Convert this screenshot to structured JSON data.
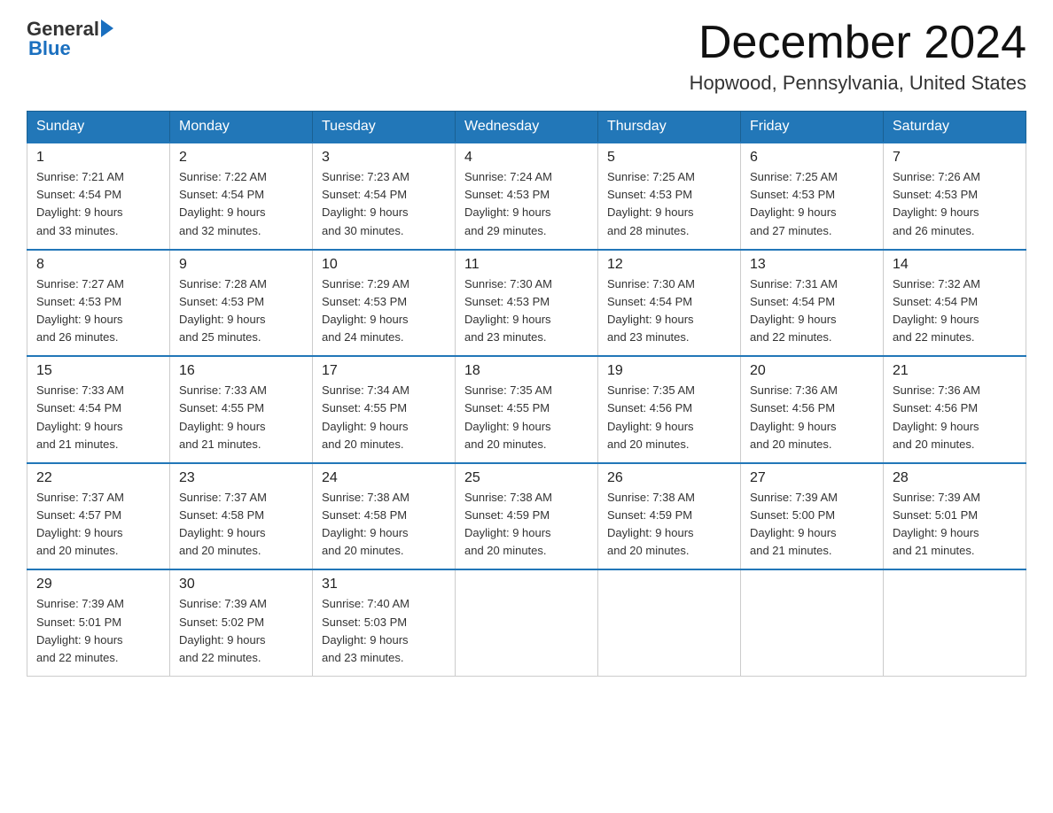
{
  "header": {
    "logo_general": "General",
    "logo_blue": "Blue",
    "title": "December 2024",
    "subtitle": "Hopwood, Pennsylvania, United States"
  },
  "days_of_week": [
    "Sunday",
    "Monday",
    "Tuesday",
    "Wednesday",
    "Thursday",
    "Friday",
    "Saturday"
  ],
  "weeks": [
    [
      {
        "day": "1",
        "sunrise": "7:21 AM",
        "sunset": "4:54 PM",
        "daylight": "9 hours and 33 minutes."
      },
      {
        "day": "2",
        "sunrise": "7:22 AM",
        "sunset": "4:54 PM",
        "daylight": "9 hours and 32 minutes."
      },
      {
        "day": "3",
        "sunrise": "7:23 AM",
        "sunset": "4:54 PM",
        "daylight": "9 hours and 30 minutes."
      },
      {
        "day": "4",
        "sunrise": "7:24 AM",
        "sunset": "4:53 PM",
        "daylight": "9 hours and 29 minutes."
      },
      {
        "day": "5",
        "sunrise": "7:25 AM",
        "sunset": "4:53 PM",
        "daylight": "9 hours and 28 minutes."
      },
      {
        "day": "6",
        "sunrise": "7:25 AM",
        "sunset": "4:53 PM",
        "daylight": "9 hours and 27 minutes."
      },
      {
        "day": "7",
        "sunrise": "7:26 AM",
        "sunset": "4:53 PM",
        "daylight": "9 hours and 26 minutes."
      }
    ],
    [
      {
        "day": "8",
        "sunrise": "7:27 AM",
        "sunset": "4:53 PM",
        "daylight": "9 hours and 26 minutes."
      },
      {
        "day": "9",
        "sunrise": "7:28 AM",
        "sunset": "4:53 PM",
        "daylight": "9 hours and 25 minutes."
      },
      {
        "day": "10",
        "sunrise": "7:29 AM",
        "sunset": "4:53 PM",
        "daylight": "9 hours and 24 minutes."
      },
      {
        "day": "11",
        "sunrise": "7:30 AM",
        "sunset": "4:53 PM",
        "daylight": "9 hours and 23 minutes."
      },
      {
        "day": "12",
        "sunrise": "7:30 AM",
        "sunset": "4:54 PM",
        "daylight": "9 hours and 23 minutes."
      },
      {
        "day": "13",
        "sunrise": "7:31 AM",
        "sunset": "4:54 PM",
        "daylight": "9 hours and 22 minutes."
      },
      {
        "day": "14",
        "sunrise": "7:32 AM",
        "sunset": "4:54 PM",
        "daylight": "9 hours and 22 minutes."
      }
    ],
    [
      {
        "day": "15",
        "sunrise": "7:33 AM",
        "sunset": "4:54 PM",
        "daylight": "9 hours and 21 minutes."
      },
      {
        "day": "16",
        "sunrise": "7:33 AM",
        "sunset": "4:55 PM",
        "daylight": "9 hours and 21 minutes."
      },
      {
        "day": "17",
        "sunrise": "7:34 AM",
        "sunset": "4:55 PM",
        "daylight": "9 hours and 20 minutes."
      },
      {
        "day": "18",
        "sunrise": "7:35 AM",
        "sunset": "4:55 PM",
        "daylight": "9 hours and 20 minutes."
      },
      {
        "day": "19",
        "sunrise": "7:35 AM",
        "sunset": "4:56 PM",
        "daylight": "9 hours and 20 minutes."
      },
      {
        "day": "20",
        "sunrise": "7:36 AM",
        "sunset": "4:56 PM",
        "daylight": "9 hours and 20 minutes."
      },
      {
        "day": "21",
        "sunrise": "7:36 AM",
        "sunset": "4:56 PM",
        "daylight": "9 hours and 20 minutes."
      }
    ],
    [
      {
        "day": "22",
        "sunrise": "7:37 AM",
        "sunset": "4:57 PM",
        "daylight": "9 hours and 20 minutes."
      },
      {
        "day": "23",
        "sunrise": "7:37 AM",
        "sunset": "4:58 PM",
        "daylight": "9 hours and 20 minutes."
      },
      {
        "day": "24",
        "sunrise": "7:38 AM",
        "sunset": "4:58 PM",
        "daylight": "9 hours and 20 minutes."
      },
      {
        "day": "25",
        "sunrise": "7:38 AM",
        "sunset": "4:59 PM",
        "daylight": "9 hours and 20 minutes."
      },
      {
        "day": "26",
        "sunrise": "7:38 AM",
        "sunset": "4:59 PM",
        "daylight": "9 hours and 20 minutes."
      },
      {
        "day": "27",
        "sunrise": "7:39 AM",
        "sunset": "5:00 PM",
        "daylight": "9 hours and 21 minutes."
      },
      {
        "day": "28",
        "sunrise": "7:39 AM",
        "sunset": "5:01 PM",
        "daylight": "9 hours and 21 minutes."
      }
    ],
    [
      {
        "day": "29",
        "sunrise": "7:39 AM",
        "sunset": "5:01 PM",
        "daylight": "9 hours and 22 minutes."
      },
      {
        "day": "30",
        "sunrise": "7:39 AM",
        "sunset": "5:02 PM",
        "daylight": "9 hours and 22 minutes."
      },
      {
        "day": "31",
        "sunrise": "7:40 AM",
        "sunset": "5:03 PM",
        "daylight": "9 hours and 23 minutes."
      },
      null,
      null,
      null,
      null
    ]
  ],
  "labels": {
    "sunrise": "Sunrise:",
    "sunset": "Sunset:",
    "daylight": "Daylight:"
  }
}
